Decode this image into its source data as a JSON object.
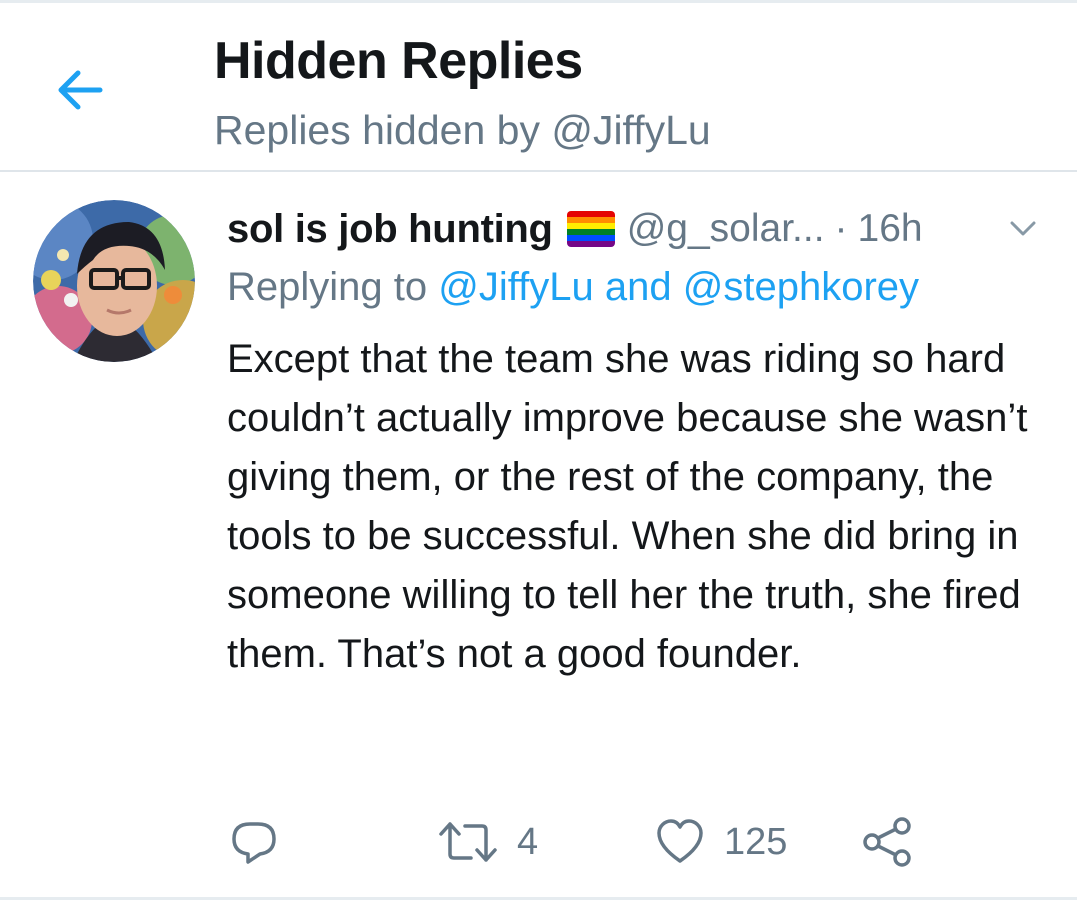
{
  "header": {
    "title": "Hidden Replies",
    "subtitle": "Replies hidden by @JiffyLu",
    "back_icon": "arrow-left-icon"
  },
  "tweet": {
    "display_name": "sol is job hunting",
    "flag_icon": "rainbow-flag-icon",
    "handle": "@g_solar...",
    "separator": "·",
    "time": "16h",
    "reply_prefix": "Replying to",
    "reply_mention_1": "@JiffyLu",
    "reply_and": "and",
    "reply_mention_2": "@stephkorey",
    "text": "Except that the team she was riding so hard couldn’t actually improve because she wasn’t giving them, or the rest of the company, the tools to be successful. When she did bring in someone willing to tell her the truth, she fired them. That’s not a good founder.",
    "actions": {
      "reply_icon": "reply-icon",
      "retweet_icon": "retweet-icon",
      "retweet_count": "4",
      "like_icon": "heart-icon",
      "like_count": "125",
      "share_icon": "share-icon"
    }
  },
  "colors": {
    "accent": "#1da1f2",
    "secondary_text": "#657786",
    "primary_text": "#14171a",
    "divider": "#dfe5ea"
  }
}
